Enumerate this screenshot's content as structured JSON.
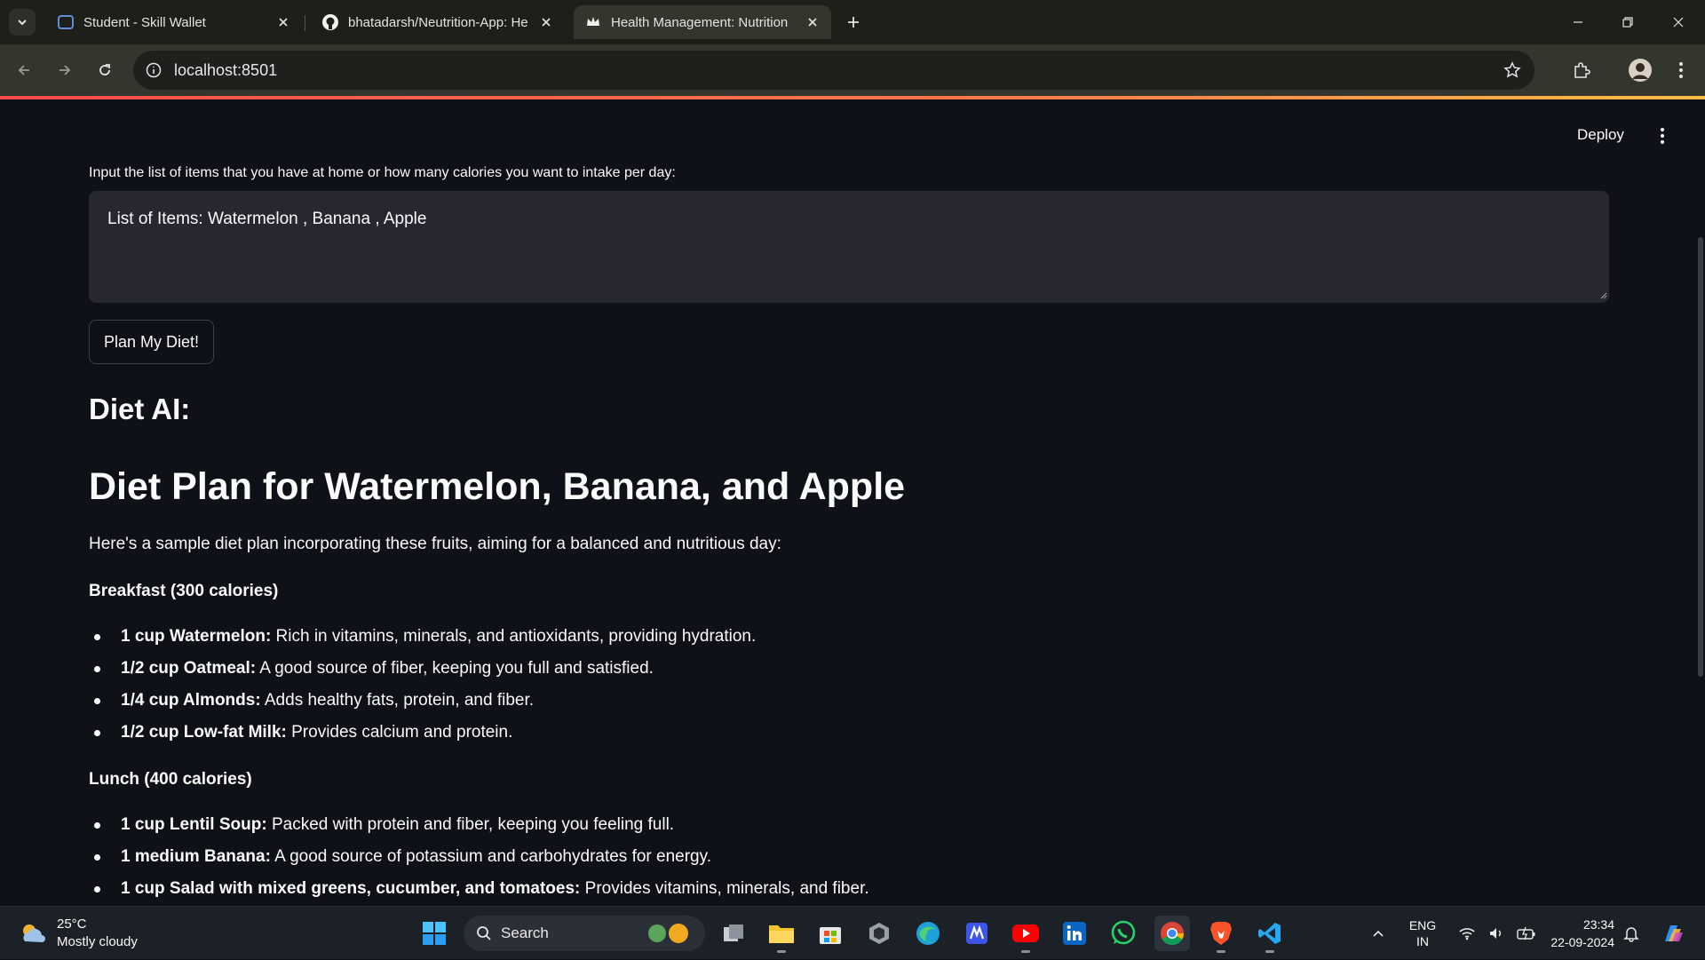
{
  "browser": {
    "tabs": [
      {
        "title": "Student - Skill Wallet",
        "active": false
      },
      {
        "title": "bhatadarsh/Neutrition-App: He",
        "active": false
      },
      {
        "title": "Health Management: Nutrition",
        "active": true
      }
    ],
    "url": "localhost:8501"
  },
  "app": {
    "deploy_label": "Deploy",
    "input_label": "Input the list of items that you have at home or how many calories you want to intake per day:",
    "input_value": "List of Items: Watermelon , Banana , Apple",
    "button_label": "Plan My Diet!",
    "response_header": "Diet AI:",
    "plan_title": "Diet Plan for Watermelon, Banana, and Apple",
    "intro": "Here's a sample diet plan incorporating these fruits, aiming for a balanced and nutritious day:",
    "breakfast": {
      "heading": "Breakfast (300 calories)",
      "items": [
        {
          "name": "1 cup Watermelon:",
          "desc": " Rich in vitamins, minerals, and antioxidants, providing hydration."
        },
        {
          "name": "1/2 cup Oatmeal:",
          "desc": " A good source of fiber, keeping you full and satisfied."
        },
        {
          "name": "1/4 cup Almonds:",
          "desc": " Adds healthy fats, protein, and fiber."
        },
        {
          "name": "1/2 cup Low-fat Milk:",
          "desc": " Provides calcium and protein."
        }
      ]
    },
    "lunch": {
      "heading": "Lunch (400 calories)",
      "items": [
        {
          "name": "1 cup Lentil Soup:",
          "desc": " Packed with protein and fiber, keeping you feeling full."
        },
        {
          "name": "1 medium Banana:",
          "desc": " A good source of potassium and carbohydrates for energy."
        },
        {
          "name": "1 cup Salad with mixed greens, cucumber, and tomatoes:",
          "desc": " Provides vitamins, minerals, and fiber."
        }
      ]
    }
  },
  "taskbar": {
    "weather_temp": "25°C",
    "weather_desc": "Mostly cloudy",
    "search_label": "Search",
    "lang_top": "ENG",
    "lang_bottom": "IN",
    "time": "23:34",
    "date": "22-09-2024"
  },
  "colors": {
    "background": "#0e1117",
    "input_bg": "#262730",
    "accent": "#ff4b4b"
  }
}
